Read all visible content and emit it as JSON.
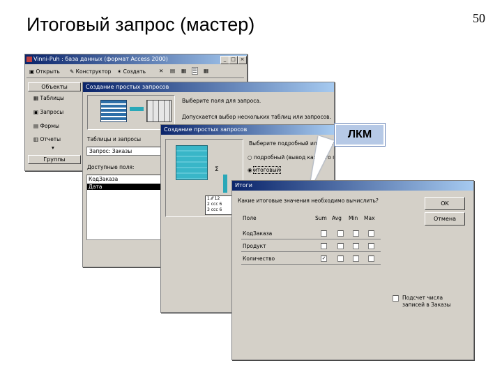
{
  "slide": {
    "title": "Итоговый запрос (мастер)",
    "number": "50"
  },
  "db_window": {
    "title": "Vinni-Puh : база данных (формат Access 2000)",
    "toolbar": {
      "open": "Открыть",
      "constructor": "Конструктор",
      "create": "Создать"
    },
    "objects_header": "Объекты",
    "objects": [
      "Таблицы",
      "Запросы",
      "Формы",
      "Отчеты"
    ],
    "groups": "Группы"
  },
  "wizard1": {
    "title": "Создание простых запросов",
    "prompt1": "Выберите поля для запроса.",
    "prompt2": "Допускается выбор нескольких таблиц или запросов.",
    "tables_label": "Таблицы и запросы",
    "tables_value": "Запрос: Заказы",
    "available_label": "Доступные поля:",
    "available_fields": [
      "КодЗаказа",
      "Дата"
    ]
  },
  "wizard2": {
    "title": "Создание простых запросов",
    "question": "Выберите подробный или итоговый отчет",
    "option1": "подробный (вывод каждого поля каждой записи)",
    "option2": "итоговый",
    "mini_rows": [
      {
        "n": "1",
        "v": "12"
      },
      {
        "n": "2",
        "v": "6"
      },
      {
        "n": "3",
        "v": "6"
      }
    ]
  },
  "callout": {
    "text": "ЛКМ"
  },
  "itogi": {
    "title": "Итоги",
    "question": "Какие итоговые значения необходимо вычислить?",
    "col_field": "Поле",
    "cols": [
      "Sum",
      "Avg",
      "Min",
      "Max"
    ],
    "rows": [
      {
        "name": "КодЗаказа",
        "checks": [
          false,
          false,
          false,
          false
        ]
      },
      {
        "name": "Продукт",
        "checks": [
          false,
          false,
          false,
          false
        ]
      },
      {
        "name": "Количество",
        "checks": [
          true,
          false,
          false,
          false
        ]
      }
    ],
    "ok": "OK",
    "cancel": "Отмена",
    "count_label_1": "Подсчет числа",
    "count_label_2": "записей в Заказы"
  }
}
